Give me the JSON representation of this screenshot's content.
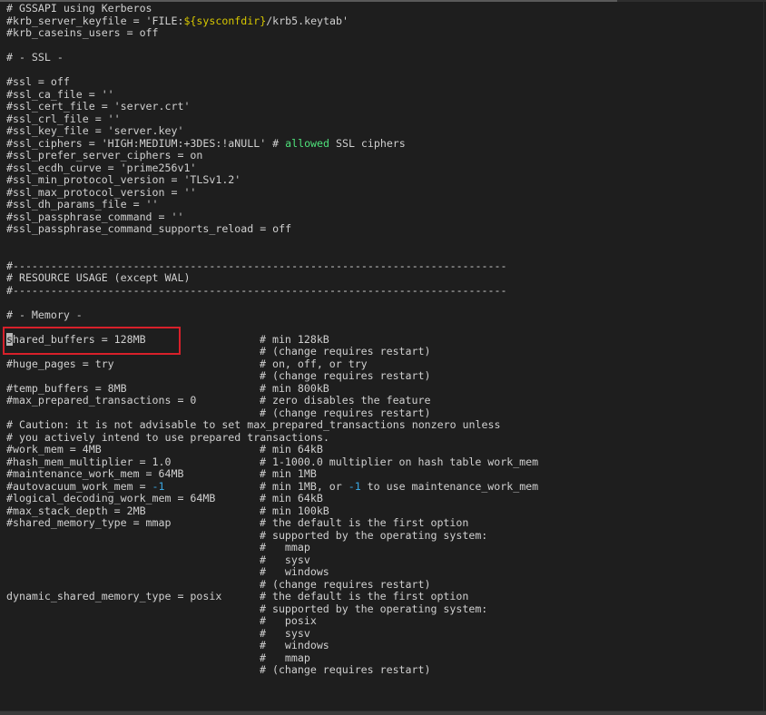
{
  "terminal": {
    "lines": [
      {
        "code": [
          "# GSSAPI using Kerberos"
        ]
      },
      {
        "code": [
          "#krb_server_keyfile = 'FILE:",
          {
            "t": "${sysconfdir}",
            "k": "y"
          },
          "/krb5.keytab'"
        ]
      },
      {
        "code": [
          "#krb_caseins_users = off"
        ]
      },
      {
        "code": [
          ""
        ]
      },
      {
        "code": [
          "# - SSL -"
        ]
      },
      {
        "code": [
          ""
        ]
      },
      {
        "code": [
          "#ssl = off"
        ]
      },
      {
        "code": [
          "#ssl_ca_file = ''"
        ]
      },
      {
        "code": [
          "#ssl_cert_file = 'server.crt'"
        ]
      },
      {
        "code": [
          "#ssl_crl_file = ''"
        ]
      },
      {
        "code": [
          "#ssl_key_file = 'server.key'"
        ]
      },
      {
        "code": [
          "#ssl_ciphers = 'HIGH:MEDIUM:+3DES:!aNULL' # ",
          {
            "t": "allowed",
            "k": "g"
          },
          " SSL ciphers"
        ]
      },
      {
        "code": [
          "#ssl_prefer_server_ciphers = on"
        ]
      },
      {
        "code": [
          "#ssl_ecdh_curve = 'prime256v1'"
        ]
      },
      {
        "code": [
          "#ssl_min_protocol_version = 'TLSv1.2'"
        ]
      },
      {
        "code": [
          "#ssl_max_protocol_version = ''"
        ]
      },
      {
        "code": [
          "#ssl_dh_params_file = ''"
        ]
      },
      {
        "code": [
          "#ssl_passphrase_command = ''"
        ]
      },
      {
        "code": [
          "#ssl_passphrase_command_supports_reload = off"
        ]
      },
      {
        "code": [
          ""
        ]
      },
      {
        "code": [
          ""
        ]
      },
      {
        "code": [
          "#------------------------------------------------------------------------------"
        ]
      },
      {
        "code": [
          "# RESOURCE USAGE (except WAL)"
        ]
      },
      {
        "code": [
          "#------------------------------------------------------------------------------"
        ]
      },
      {
        "code": [
          ""
        ]
      },
      {
        "code": [
          "# - Memory -"
        ]
      },
      {
        "code": [
          ""
        ]
      },
      {
        "code": [
          {
            "t": "s",
            "k": "cur"
          },
          "hared_buffers = 128MB"
        ],
        "comment": [
          "# min 128kB"
        ]
      },
      {
        "code": [
          ""
        ],
        "comment": [
          "# (change requires restart)"
        ]
      },
      {
        "code": [
          "#huge_pages = try"
        ],
        "comment": [
          "# on, off, or try"
        ]
      },
      {
        "code": [
          ""
        ],
        "comment": [
          "# (change requires restart)"
        ]
      },
      {
        "code": [
          "#temp_buffers = 8MB"
        ],
        "comment": [
          "# min 800kB"
        ]
      },
      {
        "code": [
          "#max_prepared_transactions = 0"
        ],
        "comment": [
          "# zero disables the feature"
        ]
      },
      {
        "code": [
          ""
        ],
        "comment": [
          "# (change requires restart)"
        ]
      },
      {
        "code": [
          "# Caution: it is not advisable to set max_prepared_transactions nonzero unless"
        ]
      },
      {
        "code": [
          "# you actively intend to use prepared transactions."
        ]
      },
      {
        "code": [
          "#work_mem = 4MB"
        ],
        "comment": [
          "# min 64kB"
        ]
      },
      {
        "code": [
          "#hash_mem_multiplier = 1.0"
        ],
        "comment": [
          "# 1-1000.0 multiplier on hash table work_mem"
        ]
      },
      {
        "code": [
          "#maintenance_work_mem = 64MB"
        ],
        "comment": [
          "# min 1MB"
        ]
      },
      {
        "code": [
          "#autovacuum_work_mem = ",
          {
            "t": "-1",
            "k": "b"
          }
        ],
        "comment": [
          "# min 1MB, or ",
          {
            "t": "-1",
            "k": "b"
          },
          " to use maintenance_work_mem"
        ]
      },
      {
        "code": [
          "#logical_decoding_work_mem = 64MB"
        ],
        "comment": [
          "# min 64kB"
        ]
      },
      {
        "code": [
          "#max_stack_depth = 2MB"
        ],
        "comment": [
          "# min 100kB"
        ]
      },
      {
        "code": [
          "#shared_memory_type = mmap"
        ],
        "comment": [
          "# the default is the first option"
        ]
      },
      {
        "code": [
          ""
        ],
        "comment": [
          "# supported by the operating system:"
        ]
      },
      {
        "code": [
          ""
        ],
        "comment": [
          "#   mmap"
        ]
      },
      {
        "code": [
          ""
        ],
        "comment": [
          "#   sysv"
        ]
      },
      {
        "code": [
          ""
        ],
        "comment": [
          "#   windows"
        ]
      },
      {
        "code": [
          ""
        ],
        "comment": [
          "# (change requires restart)"
        ]
      },
      {
        "code": [
          "dynamic_shared_memory_type = posix"
        ],
        "comment": [
          "# the default is the first option"
        ]
      },
      {
        "code": [
          ""
        ],
        "comment": [
          "# supported by the operating system:"
        ]
      },
      {
        "code": [
          ""
        ],
        "comment": [
          "#   posix"
        ]
      },
      {
        "code": [
          ""
        ],
        "comment": [
          "#   sysv"
        ]
      },
      {
        "code": [
          ""
        ],
        "comment": [
          "#   windows"
        ]
      },
      {
        "code": [
          ""
        ],
        "comment": [
          "#   mmap"
        ]
      },
      {
        "code": [
          ""
        ],
        "comment": [
          "# (change requires restart)"
        ]
      }
    ]
  },
  "colors": {
    "background": "#1e1e1e",
    "text": "#d0d0d0",
    "highlight_box": "#d8202a",
    "variable": "#d7c700",
    "keyword": "#4ee07a",
    "number": "#3aa6e0"
  }
}
